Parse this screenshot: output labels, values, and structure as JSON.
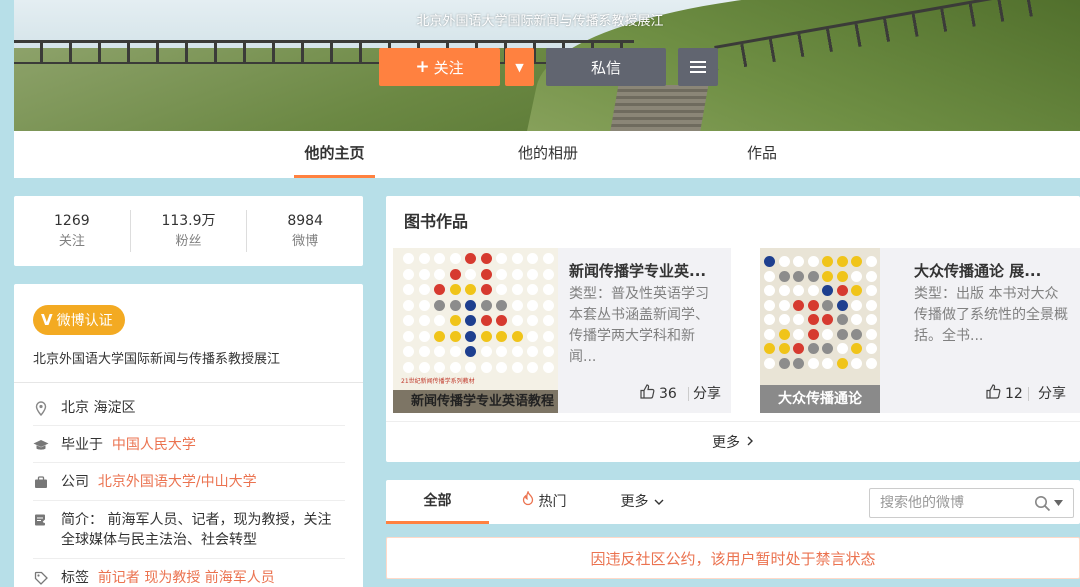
{
  "profile": {
    "name": "北京外国语大学国际新闻与传播系教授展江"
  },
  "actions": {
    "follow_label": "关注",
    "message_label": "私信"
  },
  "tabs": [
    {
      "label": "他的主页"
    },
    {
      "label": "他的相册"
    },
    {
      "label": "作品"
    }
  ],
  "counts": [
    {
      "value": "1269",
      "label": "关注"
    },
    {
      "value": "113.9万",
      "label": "粉丝"
    },
    {
      "value": "8984",
      "label": "微博"
    }
  ],
  "verification": {
    "badge": "V",
    "label": "微博认证",
    "description": "北京外国语大学国际新闻与传播系教授展江"
  },
  "info": {
    "location": "北京 海淀区",
    "edu_prefix": "毕业于",
    "edu_link": "中国人民大学",
    "company_prefix": "公司",
    "company_link": "北京外国语大学/中山大学",
    "bio_prefix": "简介：",
    "bio_text": "前海军人员、记者，现为教授，关注全球媒体与民主法治、社会转型",
    "tags_prefix": "标签",
    "tags": "前记者 现为教授 前海军人员"
  },
  "books": {
    "title": "图书作品",
    "items": [
      {
        "title": "新闻传播学专业英...",
        "desc": "类型：普及性英语学习 本套丛书涵盖新闻学、传播学两大学科和新闻...",
        "likes": "36",
        "share": "分享",
        "cover_caption": "新闻传播学专业英语教程",
        "cover_series": "21世纪新闻传播学系列教材"
      },
      {
        "title": "大众传播通论 展...",
        "desc": "类型：出版 本书对大众传播做了系统性的全景概括。全书...",
        "likes": "12",
        "share": "分享",
        "cover_caption": "大众传播通论"
      }
    ],
    "more_label": "更多"
  },
  "feed": {
    "tabs": [
      {
        "label": "全部"
      },
      {
        "label": "热门"
      },
      {
        "label": "更多"
      }
    ],
    "search_placeholder": "搜索他的微博",
    "notice": "因违反社区公约，该用户暂时处于禁言状态"
  },
  "colors": {
    "accent": "#ff8140",
    "link": "#eb7350",
    "background": "#b7dfe8",
    "dark_button": "#616570",
    "verify": "#f3aa22"
  },
  "icons": [
    "plus-icon",
    "chevron-down-icon",
    "menu-icon",
    "location-icon",
    "graduation-cap-icon",
    "briefcase-icon",
    "edit-icon",
    "tag-icon",
    "thumbs-up-icon",
    "fire-icon",
    "search-icon"
  ]
}
